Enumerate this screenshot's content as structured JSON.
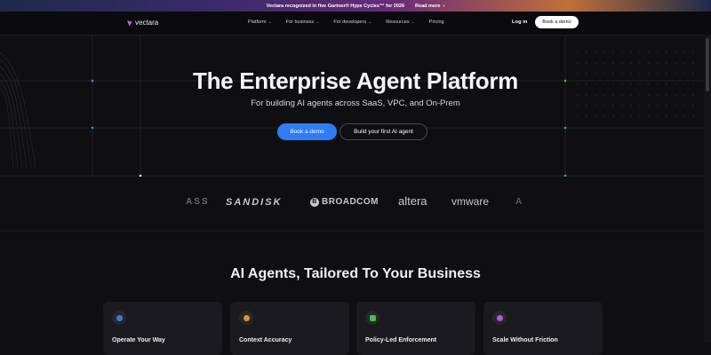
{
  "announcement": {
    "text": "Vectara recognized in five Gartner® Hype Cycles™ for 2026",
    "link": "Read more",
    "arrow": "›"
  },
  "nav": {
    "logo": "vectara",
    "items": [
      {
        "label": "Platform",
        "dropdown": true
      },
      {
        "label": "For business",
        "dropdown": true
      },
      {
        "label": "For developers",
        "dropdown": true
      },
      {
        "label": "Resources",
        "dropdown": true
      },
      {
        "label": "Pricing",
        "dropdown": false
      }
    ],
    "chevron": "⌄",
    "login": "Log in",
    "demo": "Book a demo"
  },
  "hero": {
    "title": "The Enterprise Agent Platform",
    "subtitle": "For building AI agents across SaaS, VPC, and On-Prem",
    "primary_cta": "Book a demo",
    "secondary_cta": "Build your first AI agent"
  },
  "logos": {
    "partial_left": "ASS",
    "sandisk": "SANDISK",
    "broadcom": "BROADCOM",
    "broadcom_mark": "B",
    "altera": "altera",
    "vmware": "vmware",
    "partial_right": "A"
  },
  "section": {
    "title": "AI Agents, Tailored To Your Business"
  },
  "cards": [
    {
      "title": "Operate Your Way",
      "icon": "cloud-icon",
      "color": "#3a7bd5"
    },
    {
      "title": "Context Accuracy",
      "icon": "target-icon",
      "color": "#e0932a"
    },
    {
      "title": "Policy-Led Enforcement",
      "icon": "shield-check-icon",
      "color": "#3ec24a"
    },
    {
      "title": "Scale Without Friction",
      "icon": "scale-icon",
      "color": "#b05ad8"
    }
  ],
  "colors": {
    "accent": "#2f7cf6",
    "background": "#0f0f12"
  }
}
